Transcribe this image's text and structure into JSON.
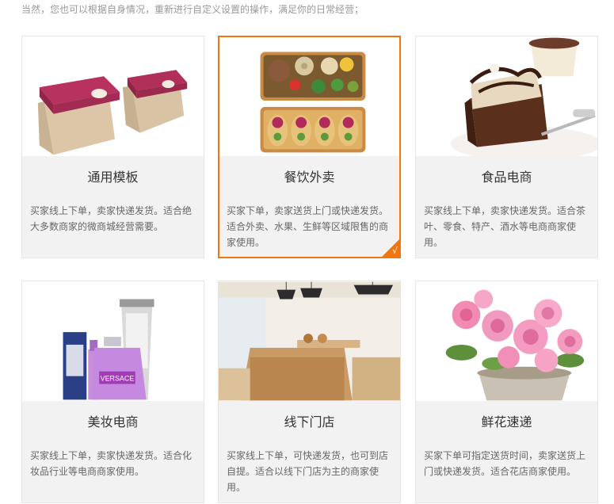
{
  "intro_text": "当然，您也可以根据自身情况，重新进行自定义设置的操作，满足你的日常经营；",
  "templates": [
    {
      "title": "通用模板",
      "description": "买家线上下单，卖家快递发货。适合绝大多数商家的微商城经营需要。",
      "image": "gift-boxes-image",
      "selected": false
    },
    {
      "title": "餐饮外卖",
      "description": "买家下单，卖家送货上门或快递发货。适合外卖、水果、生鲜等区域限售的商家使用。",
      "image": "bento-food-image",
      "selected": true
    },
    {
      "title": "食品电商",
      "description": "买家线上下单，卖家快递发货。适合茶叶、零食、特产、酒水等电商商家使用。",
      "image": "chocolate-cake-image",
      "selected": false
    },
    {
      "title": "美妆电商",
      "description": "买家线上下单，卖家快递发货。适合化妆品行业等电商商家使用。",
      "image": "cosmetics-image",
      "selected": false
    },
    {
      "title": "线下门店",
      "description": "买家线上下单，可快递发货，也可到店自提。适合以线下门店为主的商家使用。",
      "image": "store-interior-image",
      "selected": false
    },
    {
      "title": "鲜花速递",
      "description": "买家下单可指定送货时间，卖家送货上门或快递发货。适合花店商家使用。",
      "image": "pink-roses-image",
      "selected": false
    }
  ],
  "selected_check": "√",
  "colors": {
    "accent": "#f07613",
    "card_bg": "#f2f2f2",
    "border": "#e5e5e5"
  }
}
